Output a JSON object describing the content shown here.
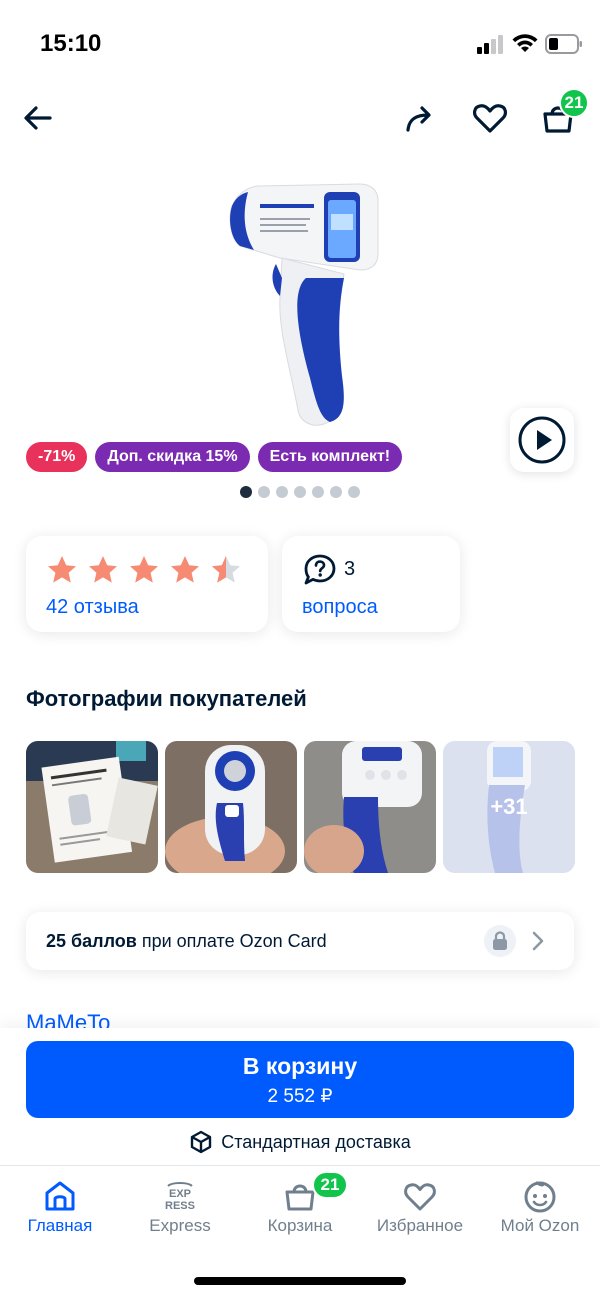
{
  "status_bar": {
    "time": "15:10"
  },
  "header": {
    "cart_count": "21"
  },
  "product": {
    "badges": [
      "-71%",
      "Доп. скидка 15%",
      "Есть комплект!"
    ],
    "rating_value": 4.5,
    "reviews_label": "42 отзыва",
    "questions_count": "3",
    "questions_label": "вопроса"
  },
  "customer_photos": {
    "title": "Фотографии покупателей",
    "more_label": "+31"
  },
  "points": {
    "bold": "25 баллов",
    "rest": " при оплате Ozon Card"
  },
  "seller": {
    "name": "MaMeTo"
  },
  "buy": {
    "label": "В корзину",
    "price": "2 552 ₽"
  },
  "delivery": {
    "label": "Стандартная доставка"
  },
  "tabbar": {
    "home": "Главная",
    "express": "Express",
    "cart": "Корзина",
    "cart_count": "21",
    "favorites": "Избранное",
    "profile": "Мой Ozon"
  },
  "colors": {
    "accent": "#005bff",
    "green": "#10c44c",
    "red_badge": "#e8315b",
    "purple_badge": "#7b2bb2",
    "star": "#f78a72"
  }
}
